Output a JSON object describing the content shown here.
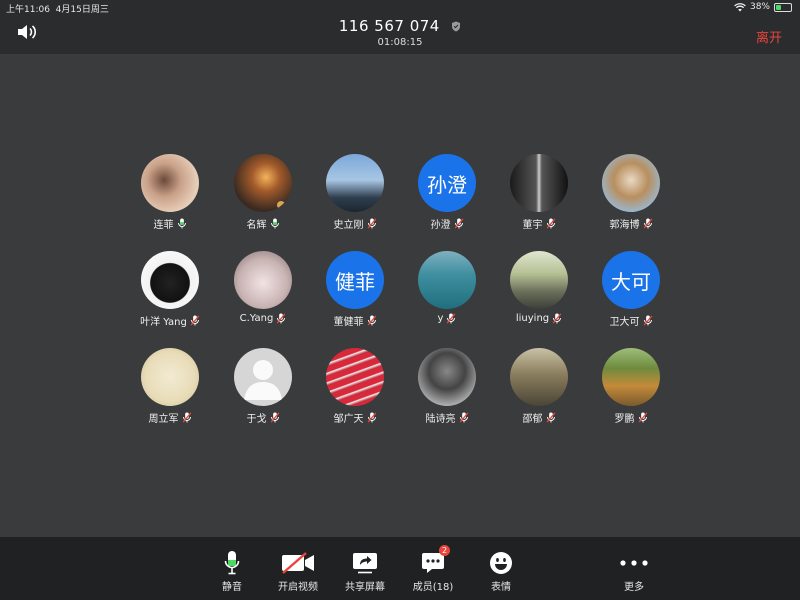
{
  "status_bar": {
    "time": "上午11:06",
    "date": "4月15日周三",
    "battery": "38%",
    "battery_level": 0.38
  },
  "header": {
    "meeting_id": "116 567 074",
    "elapsed": "01:08:15",
    "leave_label": "离开"
  },
  "participants": [
    {
      "name": "连菲",
      "mic": "on",
      "avatar": {
        "type": "photo",
        "bg": "radial-gradient(circle at 40% 45%, #6b4a3a 0%, #c9a088 35%, #e6cdb8 70%)"
      }
    },
    {
      "name": "名辉",
      "mic": "on",
      "host": true,
      "avatar": {
        "type": "photo",
        "bg": "radial-gradient(circle at 55% 40%, #f3b35a 0%, #a25a2a 30%, #3a2a22 70%)"
      }
    },
    {
      "name": "史立刚",
      "mic": "muted",
      "avatar": {
        "type": "photo",
        "bg": "linear-gradient(180deg, #7aa8d8 0%, #a8c6e4 45%, #2f3f4f 75%, #1c2630 100%)"
      }
    },
    {
      "name": "孙澄",
      "mic": "muted",
      "avatar": {
        "type": "text",
        "text": "孙澄",
        "bg": "#1a73e8"
      }
    },
    {
      "name": "董宇",
      "mic": "muted",
      "avatar": {
        "type": "photo",
        "bg": "linear-gradient(90deg, #1a1a1a 0%, #555 45%, #ccc 50%, #555 55%, #111 100%)"
      }
    },
    {
      "name": "郭海博",
      "mic": "muted",
      "avatar": {
        "type": "photo",
        "bg": "radial-gradient(circle at 50% 45%, #e8d9c4 0%, #b88f5f 40%, #9bb7cf 75%)"
      }
    },
    {
      "name": "叶洋 Yang",
      "mic": "muted",
      "avatar": {
        "type": "photo",
        "bg": "radial-gradient(circle at 50% 55%, #222 0%, #111 45%, #f2f2f2 47%, #fff 100%)"
      }
    },
    {
      "name": "C.Yang",
      "mic": "muted",
      "avatar": {
        "type": "photo",
        "bg": "radial-gradient(circle at 50% 55%, #f2e4e4 0%, #c9b3b3 55%, #7b6b6b 100%)"
      }
    },
    {
      "name": "董健菲",
      "mic": "muted",
      "avatar": {
        "type": "text",
        "text": "健菲",
        "bg": "#1a73e8"
      }
    },
    {
      "name": "y",
      "mic": "muted",
      "avatar": {
        "type": "photo",
        "bg": "linear-gradient(180deg, #7fb0c0 0%, #3f8fa0 40%, #1f6f7e 100%)"
      }
    },
    {
      "name": "liuying",
      "mic": "muted",
      "avatar": {
        "type": "photo",
        "bg": "linear-gradient(180deg, #dfe6d0 0%, #b3bf92 40%, #6a6f5a 70%, #3d3f38 100%)"
      }
    },
    {
      "name": "卫大可",
      "mic": "muted",
      "avatar": {
        "type": "text",
        "text": "大可",
        "bg": "#1a73e8"
      }
    },
    {
      "name": "周立军",
      "mic": "muted",
      "avatar": {
        "type": "photo",
        "bg": "radial-gradient(circle at 50% 50%, #f2ead2 0%, #e8dcb8 60%, #c9b88c 100%)"
      }
    },
    {
      "name": "于戈",
      "mic": "muted",
      "avatar": {
        "type": "default",
        "bg": "#d6d6d6"
      }
    },
    {
      "name": "邹广天",
      "mic": "muted",
      "avatar": {
        "type": "photo",
        "bg": "repeating-linear-gradient(160deg, #d8283a 0px, #d8283a 5px, #f3f3f3 6px, #b81e2e 9px)"
      }
    },
    {
      "name": "陆诗亮",
      "mic": "muted",
      "avatar": {
        "type": "photo",
        "bg": "radial-gradient(circle at 50% 40%, #888 0%, #444 40%, #bbb 80%)"
      }
    },
    {
      "name": "邵郁",
      "mic": "muted",
      "avatar": {
        "type": "photo",
        "bg": "linear-gradient(180deg, #c9c1a6 0%, #8b7e5e 45%, #4a4536 100%)"
      }
    },
    {
      "name": "罗鹏",
      "mic": "muted",
      "avatar": {
        "type": "photo",
        "bg": "linear-gradient(180deg, #9ebd7a 0%, #6e8b3d 35%, #c48a3a 65%, #7a5a2e 100%)"
      }
    }
  ],
  "toolbar": {
    "mute_label": "静音",
    "video_label": "开启视频",
    "share_label": "共享屏幕",
    "members_label": "成员(18)",
    "members_badge": "2",
    "emoji_label": "表情",
    "more_label": "更多"
  },
  "colors": {
    "accent_blue": "#1a73e8",
    "danger_red": "#e8453c",
    "mic_green": "#4cd964"
  }
}
